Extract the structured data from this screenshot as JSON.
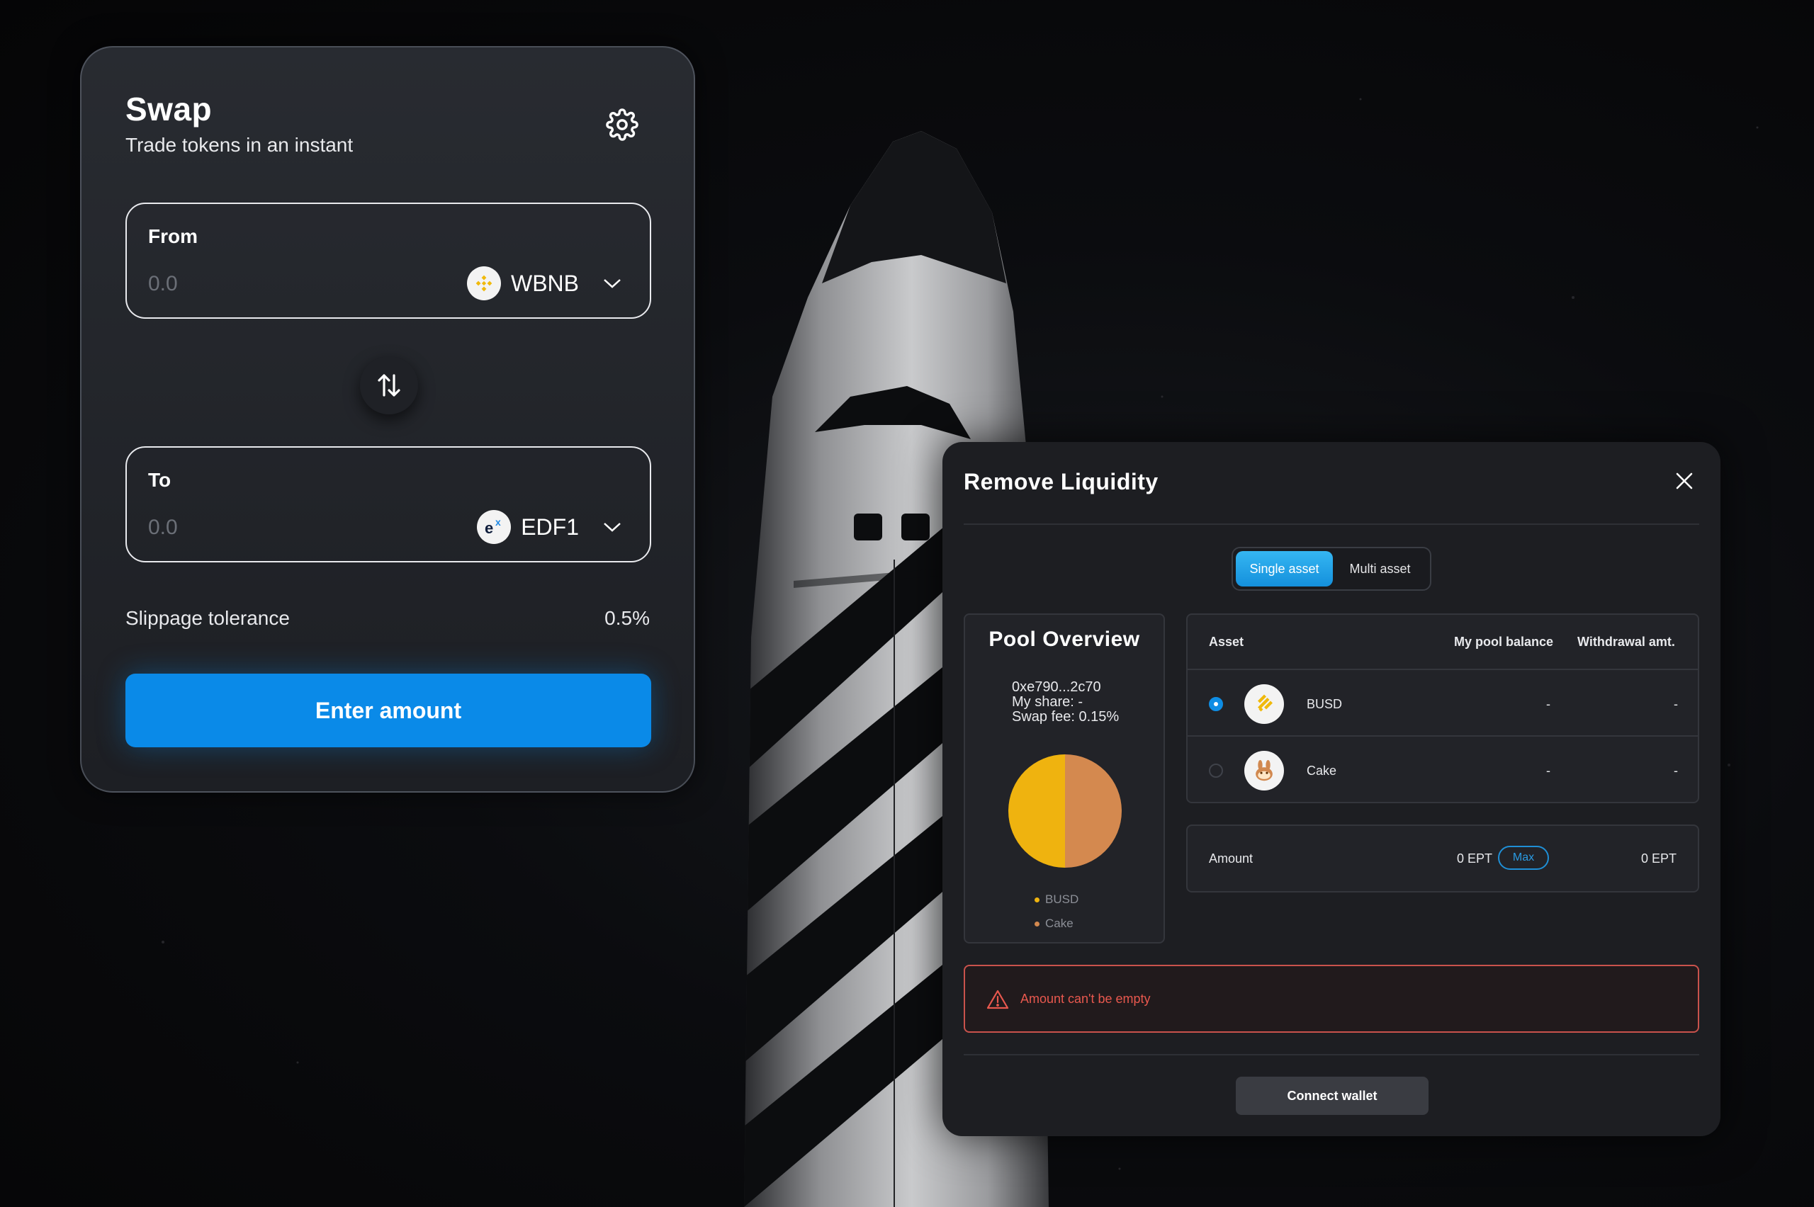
{
  "swap": {
    "title": "Swap",
    "subtitle": "Trade tokens in an instant",
    "from": {
      "label": "From",
      "amount": "0.0",
      "token": "WBNB"
    },
    "to": {
      "label": "To",
      "amount": "0.0",
      "token": "EDF1"
    },
    "slippage_label": "Slippage tolerance",
    "slippage_value": "0.5%",
    "enter_amount_label": "Enter amount"
  },
  "remove_liquidity": {
    "title": "Remove Liquidity",
    "tabs": [
      "Single asset",
      "Multi asset"
    ],
    "active_tab": 0,
    "pool_overview": {
      "title": "Pool Overview",
      "address": "0xe790...2c70",
      "my_share": "My share: -",
      "swap_fee": "Swap fee: 0.15%",
      "legend": [
        {
          "name": "BUSD",
          "color": "#efb30f"
        },
        {
          "name": "Cake",
          "color": "#d4894f"
        }
      ],
      "shares": [
        0.5,
        0.5
      ]
    },
    "table": {
      "headers": {
        "asset": "Asset",
        "balance": "My pool balance",
        "withdraw": "Withdrawal amt."
      },
      "rows": [
        {
          "asset": "BUSD",
          "balance": "-",
          "withdraw": "-",
          "selected": true
        },
        {
          "asset": "Cake",
          "balance": "-",
          "withdraw": "-",
          "selected": false
        }
      ]
    },
    "amount": {
      "label": "Amount",
      "value": "0 EPT",
      "max_label": "Max",
      "result": "0 EPT"
    },
    "error": "Amount can't be empty",
    "connect_wallet": "Connect wallet"
  },
  "colors": {
    "accent_blue": "#0a8ae8",
    "error_red": "#e8584e",
    "busd_yellow": "#efb30f",
    "cake_orange": "#d4894f"
  },
  "icons": {
    "settings": "gear-icon",
    "swap_direction": "swap-arrows-icon",
    "dropdown": "chevron-down-icon",
    "close": "close-icon",
    "warning": "warning-icon"
  }
}
